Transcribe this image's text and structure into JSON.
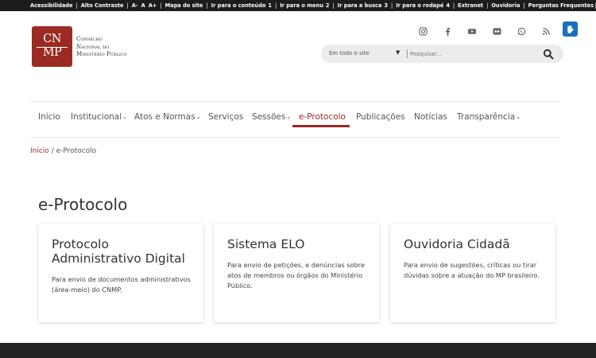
{
  "topbar": {
    "acessibilidade": "Acessibilidade",
    "alto_contraste": "Alto Contraste",
    "font_a_minus": "A-",
    "font_a": "A",
    "font_a_plus": "A+",
    "mapa": "Mapa do site",
    "ir_conteudo": "Ir para o conteúdo",
    "ir_conteudo_key": "1",
    "ir_menu": "Ir para o menu",
    "ir_menu_key": "2",
    "ir_busca": "Ir para a busca",
    "ir_busca_key": "3",
    "ir_rodape": "Ir para o rodapé",
    "ir_rodape_key": "4",
    "extranet": "Extranet",
    "ouvidoria": "Ouvidoria",
    "perguntas": "Perguntas Frequentes"
  },
  "logo": {
    "mark_line1": "CN",
    "mark_line2": "MP",
    "name_line1": "Conselho",
    "name_line2": "Nacional do",
    "name_line3": "Ministério Público",
    "brand_color": "#9b2a23"
  },
  "social_icons": [
    "instagram-icon",
    "facebook-icon",
    "youtube-icon",
    "flickr-icon",
    "whatsapp-icon",
    "rss-icon"
  ],
  "search": {
    "scope": "Em todo o site",
    "placeholder": "Pesquisar..."
  },
  "nav": {
    "items": [
      {
        "label": "Início",
        "has_dropdown": false
      },
      {
        "label": "Institucional",
        "has_dropdown": true
      },
      {
        "label": "Atos e Normas",
        "has_dropdown": true
      },
      {
        "label": "Serviços",
        "has_dropdown": false
      },
      {
        "label": "Sessões",
        "has_dropdown": true
      },
      {
        "label": "e-Protocolo",
        "has_dropdown": false,
        "active": true
      },
      {
        "label": "Publicações",
        "has_dropdown": false
      },
      {
        "label": "Notícias",
        "has_dropdown": false
      },
      {
        "label": "Transparência",
        "has_dropdown": true
      }
    ]
  },
  "breadcrumb": {
    "home": "Início",
    "separator": "/",
    "current": "e-Protocolo"
  },
  "page": {
    "title": "e-Protocolo"
  },
  "cards": [
    {
      "title": "Protocolo Administrativo Digital",
      "desc": "Para envio de documentos administrativos (área-meio) do CNMP."
    },
    {
      "title": "Sistema ELO",
      "desc": "Para envio de petições, e denúncias sobre atos de membros ou órgãos do Ministério Público."
    },
    {
      "title": "Ouvidoria Cidadã",
      "desc": "Para envio de sugestões, críticas ou tirar dúvidas sobre a atuação do MP brasileiro."
    }
  ]
}
